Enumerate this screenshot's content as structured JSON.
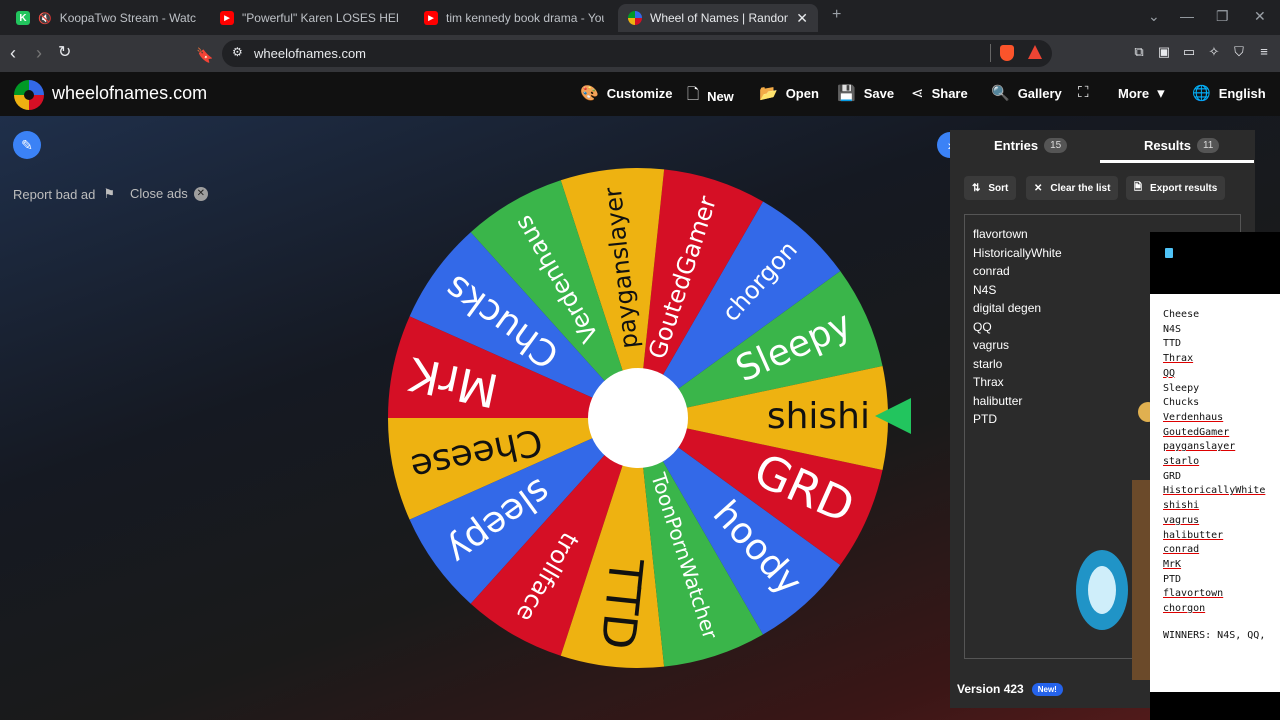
{
  "browser": {
    "tabs": [
      {
        "title": "KoopaTwo Stream - Watch Live o",
        "favicon": "K",
        "color": "#22c55e"
      },
      {
        "title": "\"Powerful\" Karen LOSES HER MIND W",
        "favicon": "▶",
        "color": "#ff0000"
      },
      {
        "title": "tim kennedy book drama - YouTube",
        "favicon": "▶",
        "color": "#ff0000"
      },
      {
        "title": "Wheel of Names | Random name",
        "favicon": "",
        "color": "#3b82f6",
        "active": true
      }
    ],
    "url": "wheelofnames.com",
    "new_tab": "+"
  },
  "site": {
    "name": "wheelofnames.com",
    "menu": [
      {
        "label": "Customize",
        "icon": "palette-icon"
      },
      {
        "label": "New",
        "icon": "file-icon"
      },
      {
        "label": "Open",
        "icon": "folder-icon"
      },
      {
        "label": "Save",
        "icon": "save-icon"
      },
      {
        "label": "Share",
        "icon": "share-icon"
      },
      {
        "label": "Gallery",
        "icon": "search-icon"
      },
      {
        "label": "",
        "icon": "fullscreen-icon"
      },
      {
        "label": "More",
        "icon": "chevron-down-icon"
      },
      {
        "label": "English",
        "icon": "globe-icon"
      }
    ]
  },
  "ads": {
    "report": "Report bad ad",
    "close": "Close ads"
  },
  "wheel": {
    "segments": [
      {
        "label": "Sleepy",
        "color": "#3ab54a"
      },
      {
        "label": "chorgon",
        "color": "#3369e8"
      },
      {
        "label": "GoutedGamer",
        "color": "#d50f25"
      },
      {
        "label": "payganslayer",
        "color": "#eeb211"
      },
      {
        "label": "Verdenhaus",
        "color": "#3ab54a"
      },
      {
        "label": "Chucks",
        "color": "#3369e8"
      },
      {
        "label": "MrK",
        "color": "#d50f25"
      },
      {
        "label": "Cheese",
        "color": "#eeb211"
      },
      {
        "label": "sleepy",
        "color": "#3369e8"
      },
      {
        "label": "trollface",
        "color": "#d50f25"
      },
      {
        "label": "TTD",
        "color": "#eeb211"
      },
      {
        "label": "ToonPornWatcher",
        "color": "#3ab54a"
      },
      {
        "label": "hoody",
        "color": "#3369e8"
      },
      {
        "label": "GRD",
        "color": "#d50f25"
      },
      {
        "label": "shishi",
        "color": "#eeb211"
      }
    ]
  },
  "panel": {
    "entries_label": "Entries",
    "entries_count": "15",
    "results_label": "Results",
    "results_count": "11",
    "sort": "Sort",
    "clear": "Clear the list",
    "export": "Export results",
    "results": [
      "flavortown",
      "HistoricallyWhite",
      "conrad",
      "N4S",
      "digital degen",
      "QQ",
      "vagrus",
      "starlo",
      "Thrax",
      "halibutter",
      "PTD"
    ],
    "version": "Version 423",
    "new_badge": "New!"
  },
  "overlay": {
    "names": [
      {
        "t": "Cheese",
        "u": false
      },
      {
        "t": "N4S",
        "u": false
      },
      {
        "t": "TTD",
        "u": false
      },
      {
        "t": "Thrax",
        "u": true
      },
      {
        "t": "QQ",
        "u": true
      },
      {
        "t": "Sleepy",
        "u": false
      },
      {
        "t": "Chucks",
        "u": false
      },
      {
        "t": "Verdenhaus",
        "u": true
      },
      {
        "t": "GoutedGamer",
        "u": true
      },
      {
        "t": "payganslayer",
        "u": true
      },
      {
        "t": "starlo",
        "u": true
      },
      {
        "t": "GRD",
        "u": false
      },
      {
        "t": "HistoricallyWhite",
        "u": true
      },
      {
        "t": "shishi",
        "u": true
      },
      {
        "t": "vagrus",
        "u": true
      },
      {
        "t": "halibutter",
        "u": true
      },
      {
        "t": "conrad",
        "u": true
      },
      {
        "t": "MrK",
        "u": true
      },
      {
        "t": "PTD",
        "u": false
      },
      {
        "t": "flavortown",
        "u": true
      },
      {
        "t": "chorgon",
        "u": true
      }
    ],
    "winners": "WINNERS: N4S, QQ,"
  }
}
